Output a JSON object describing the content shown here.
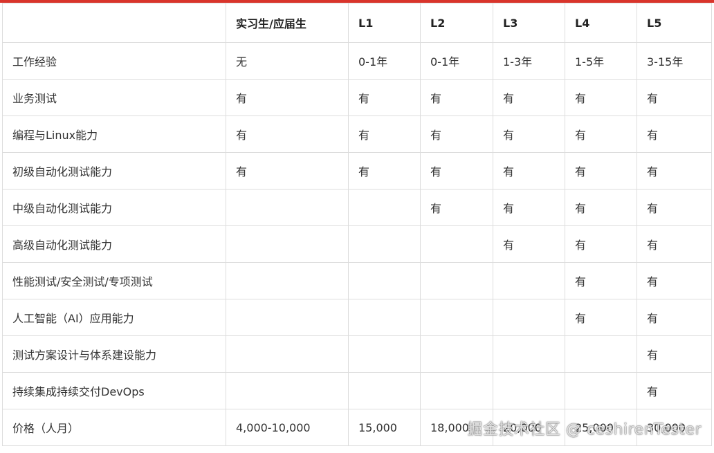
{
  "headers": [
    "",
    "实习生/应届生",
    "L1",
    "L2",
    "L3",
    "L4",
    "L5"
  ],
  "rows": [
    [
      "工作经验",
      "无",
      "0-1年",
      "0-1年",
      "1-3年",
      "1-5年",
      "3-15年"
    ],
    [
      "业务测试",
      "有",
      "有",
      "有",
      "有",
      "有",
      "有"
    ],
    [
      "编程与Linux能力",
      "有",
      "有",
      "有",
      "有",
      "有",
      "有"
    ],
    [
      "初级自动化测试能力",
      "有",
      "有",
      "有",
      "有",
      "有",
      "有"
    ],
    [
      "中级自动化测试能力",
      "",
      "",
      "有",
      "有",
      "有",
      "有"
    ],
    [
      "高级自动化测试能力",
      "",
      "",
      "",
      "有",
      "有",
      "有"
    ],
    [
      "性能测试/安全测试/专项测试",
      "",
      "",
      "",
      "",
      "有",
      "有"
    ],
    [
      "人工智能（AI）应用能力",
      "",
      "",
      "",
      "",
      "有",
      "有"
    ],
    [
      "测试方案设计与体系建设能力",
      "",
      "",
      "",
      "",
      "",
      "有"
    ],
    [
      "持续集成持续交付DevOps",
      "",
      "",
      "",
      "",
      "",
      "有"
    ],
    [
      "价格（人月）",
      "4,000-10,000",
      "15,000",
      "18,000",
      "20,000",
      "25,000",
      "30,000"
    ]
  ],
  "watermark": "掘金技术社区 @ ceshirenTester",
  "colors": {
    "accent_bar": "#d9342b",
    "border": "#dddddd",
    "text": "#333333"
  }
}
